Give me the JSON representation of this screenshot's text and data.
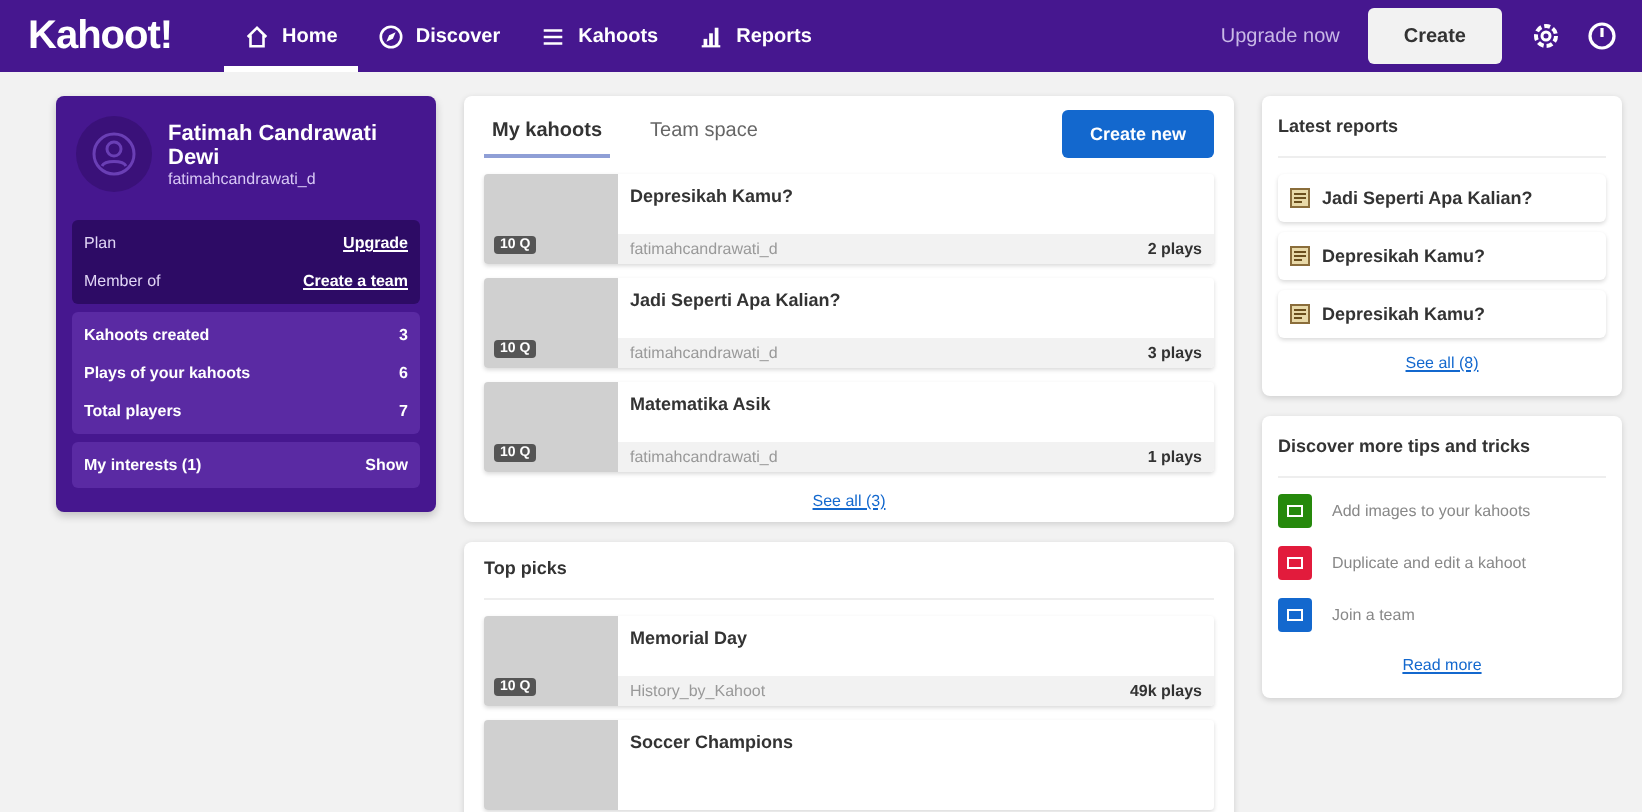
{
  "nav": {
    "logo": "Kahoot!",
    "items": [
      {
        "label": "Home",
        "kind": "home",
        "selected": true
      },
      {
        "label": "Discover",
        "kind": "discover",
        "selected": false
      },
      {
        "label": "Kahoots",
        "kind": "kahoots",
        "selected": false
      },
      {
        "label": "Reports",
        "kind": "reports",
        "selected": false
      }
    ],
    "upgrade": "Upgrade now",
    "create": "Create"
  },
  "profile": {
    "name": "Fatimah Candrawati Dewi",
    "username": "fatimahcandrawati_d",
    "account": [
      {
        "label": "Plan",
        "action": "Upgrade"
      },
      {
        "label": "Member of",
        "action": "Create a team"
      }
    ],
    "stats": [
      {
        "label": "Kahoots created",
        "value": "3"
      },
      {
        "label": "Plays of your kahoots",
        "value": "6"
      },
      {
        "label": "Total players",
        "value": "7"
      }
    ],
    "interests": {
      "label": "My interests (1)",
      "action": "Show"
    }
  },
  "my_kahoots": {
    "tabs": [
      {
        "label": "My kahoots",
        "selected": true
      },
      {
        "label": "Team space",
        "selected": false
      }
    ],
    "create_button": "Create new",
    "items": [
      {
        "title": "Depresikah Kamu?",
        "badge": "10 Q",
        "author": "fatimahcandrawati_d",
        "plays": "2 plays"
      },
      {
        "title": "Jadi Seperti Apa Kalian?",
        "badge": "10 Q",
        "author": "fatimahcandrawati_d",
        "plays": "3 plays"
      },
      {
        "title": "Matematika Asik",
        "badge": "10 Q",
        "author": "fatimahcandrawati_d",
        "plays": "1 plays"
      }
    ],
    "see_all": "See all (3)"
  },
  "top_picks": {
    "title": "Top picks",
    "items": [
      {
        "title": "Memorial Day",
        "badge": "10 Q",
        "author": "History_by_Kahoot",
        "plays": "49k plays"
      },
      {
        "title": "Soccer Champions"
      }
    ]
  },
  "latest_reports": {
    "title": "Latest reports",
    "items": [
      "Jadi Seperti Apa Kalian?",
      "Depresikah Kamu?",
      "Depresikah Kamu?"
    ],
    "see_all": "See all (8)"
  },
  "tips": {
    "title": "Discover more tips and tricks",
    "items": [
      {
        "label": "Add images to your kahoots",
        "color": "#26890c"
      },
      {
        "label": "Duplicate and edit a kahoot",
        "color": "#e21b3c"
      },
      {
        "label": "Join a team",
        "color": "#1368ce"
      }
    ],
    "read_more": "Read more"
  }
}
